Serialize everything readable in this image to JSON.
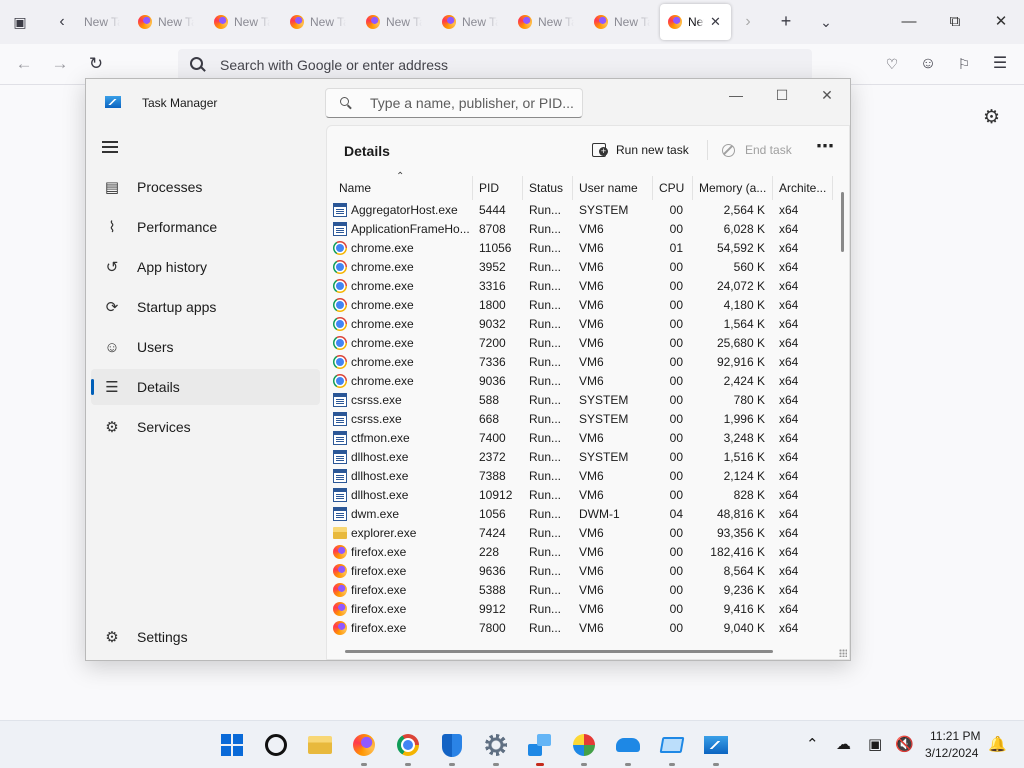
{
  "browser": {
    "tabs": [
      {
        "title": "New Tab"
      },
      {
        "title": "New Tab"
      },
      {
        "title": "New Tab"
      },
      {
        "title": "New Tab"
      },
      {
        "title": "New Tab"
      },
      {
        "title": "New Tab"
      },
      {
        "title": "New Tab"
      },
      {
        "title": "New Tab"
      },
      {
        "title": "New Tab"
      }
    ],
    "address_placeholder": "Search with Google or enter address"
  },
  "task_manager": {
    "window_title": "Task Manager",
    "search_placeholder": "Type a name, publisher, or PID...",
    "nav": {
      "items": [
        {
          "label": "Processes",
          "icon": "processes-icon"
        },
        {
          "label": "Performance",
          "icon": "performance-icon"
        },
        {
          "label": "App history",
          "icon": "history-icon"
        },
        {
          "label": "Startup apps",
          "icon": "startup-icon"
        },
        {
          "label": "Users",
          "icon": "users-icon"
        },
        {
          "label": "Details",
          "icon": "details-icon",
          "selected": true
        },
        {
          "label": "Services",
          "icon": "services-icon"
        }
      ],
      "settings_label": "Settings"
    },
    "details": {
      "title": "Details",
      "run_new_task": "Run new task",
      "end_task": "End task",
      "columns": [
        "Name",
        "PID",
        "Status",
        "User name",
        "CPU",
        "Memory (a...",
        "Archite..."
      ],
      "rows": [
        {
          "name": "AggregatorHost.exe",
          "icon": "app",
          "pid": "5444",
          "status": "Run...",
          "user": "SYSTEM",
          "cpu": "00",
          "memory": "2,564 K",
          "arch": "x64"
        },
        {
          "name": "ApplicationFrameHo...",
          "icon": "app",
          "pid": "8708",
          "status": "Run...",
          "user": "VM6",
          "cpu": "00",
          "memory": "6,028 K",
          "arch": "x64"
        },
        {
          "name": "chrome.exe",
          "icon": "chrome",
          "pid": "11056",
          "status": "Run...",
          "user": "VM6",
          "cpu": "01",
          "memory": "54,592 K",
          "arch": "x64"
        },
        {
          "name": "chrome.exe",
          "icon": "chrome",
          "pid": "3952",
          "status": "Run...",
          "user": "VM6",
          "cpu": "00",
          "memory": "560 K",
          "arch": "x64"
        },
        {
          "name": "chrome.exe",
          "icon": "chrome",
          "pid": "3316",
          "status": "Run...",
          "user": "VM6",
          "cpu": "00",
          "memory": "24,072 K",
          "arch": "x64"
        },
        {
          "name": "chrome.exe",
          "icon": "chrome",
          "pid": "1800",
          "status": "Run...",
          "user": "VM6",
          "cpu": "00",
          "memory": "4,180 K",
          "arch": "x64"
        },
        {
          "name": "chrome.exe",
          "icon": "chrome",
          "pid": "9032",
          "status": "Run...",
          "user": "VM6",
          "cpu": "00",
          "memory": "1,564 K",
          "arch": "x64"
        },
        {
          "name": "chrome.exe",
          "icon": "chrome",
          "pid": "7200",
          "status": "Run...",
          "user": "VM6",
          "cpu": "00",
          "memory": "25,680 K",
          "arch": "x64"
        },
        {
          "name": "chrome.exe",
          "icon": "chrome",
          "pid": "7336",
          "status": "Run...",
          "user": "VM6",
          "cpu": "00",
          "memory": "92,916 K",
          "arch": "x64"
        },
        {
          "name": "chrome.exe",
          "icon": "chrome",
          "pid": "9036",
          "status": "Run...",
          "user": "VM6",
          "cpu": "00",
          "memory": "2,424 K",
          "arch": "x64"
        },
        {
          "name": "csrss.exe",
          "icon": "app",
          "pid": "588",
          "status": "Run...",
          "user": "SYSTEM",
          "cpu": "00",
          "memory": "780 K",
          "arch": "x64"
        },
        {
          "name": "csrss.exe",
          "icon": "app",
          "pid": "668",
          "status": "Run...",
          "user": "SYSTEM",
          "cpu": "00",
          "memory": "1,996 K",
          "arch": "x64"
        },
        {
          "name": "ctfmon.exe",
          "icon": "app",
          "pid": "7400",
          "status": "Run...",
          "user": "VM6",
          "cpu": "00",
          "memory": "3,248 K",
          "arch": "x64"
        },
        {
          "name": "dllhost.exe",
          "icon": "app",
          "pid": "2372",
          "status": "Run...",
          "user": "SYSTEM",
          "cpu": "00",
          "memory": "1,516 K",
          "arch": "x64"
        },
        {
          "name": "dllhost.exe",
          "icon": "app",
          "pid": "7388",
          "status": "Run...",
          "user": "VM6",
          "cpu": "00",
          "memory": "2,124 K",
          "arch": "x64"
        },
        {
          "name": "dllhost.exe",
          "icon": "app",
          "pid": "10912",
          "status": "Run...",
          "user": "VM6",
          "cpu": "00",
          "memory": "828 K",
          "arch": "x64"
        },
        {
          "name": "dwm.exe",
          "icon": "app",
          "pid": "1056",
          "status": "Run...",
          "user": "DWM-1",
          "cpu": "04",
          "memory": "48,816 K",
          "arch": "x64"
        },
        {
          "name": "explorer.exe",
          "icon": "folder",
          "pid": "7424",
          "status": "Run...",
          "user": "VM6",
          "cpu": "00",
          "memory": "93,356 K",
          "arch": "x64"
        },
        {
          "name": "firefox.exe",
          "icon": "firefox",
          "pid": "228",
          "status": "Run...",
          "user": "VM6",
          "cpu": "00",
          "memory": "182,416 K",
          "arch": "x64"
        },
        {
          "name": "firefox.exe",
          "icon": "firefox",
          "pid": "9636",
          "status": "Run...",
          "user": "VM6",
          "cpu": "00",
          "memory": "8,564 K",
          "arch": "x64"
        },
        {
          "name": "firefox.exe",
          "icon": "firefox",
          "pid": "5388",
          "status": "Run...",
          "user": "VM6",
          "cpu": "00",
          "memory": "9,236 K",
          "arch": "x64"
        },
        {
          "name": "firefox.exe",
          "icon": "firefox",
          "pid": "9912",
          "status": "Run...",
          "user": "VM6",
          "cpu": "00",
          "memory": "9,416 K",
          "arch": "x64"
        },
        {
          "name": "firefox.exe",
          "icon": "firefox",
          "pid": "7800",
          "status": "Run...",
          "user": "VM6",
          "cpu": "00",
          "memory": "9,040 K",
          "arch": "x64"
        }
      ]
    }
  },
  "taskbar": {
    "apps": [
      {
        "name": "start-button"
      },
      {
        "name": "search-app"
      },
      {
        "name": "file-explorer-app"
      },
      {
        "name": "firefox-app"
      },
      {
        "name": "chrome-app"
      },
      {
        "name": "defender-app"
      },
      {
        "name": "settings-app"
      },
      {
        "name": "remote-app"
      },
      {
        "name": "paint-app"
      },
      {
        "name": "onedrive-app"
      },
      {
        "name": "display-app"
      },
      {
        "name": "task-manager-app"
      }
    ],
    "time": "11:21 PM",
    "date": "3/12/2024"
  },
  "colors": {
    "accent": "#005fb8",
    "taskbar": "#eef1f6",
    "active_indicator": "#c42b1c"
  }
}
